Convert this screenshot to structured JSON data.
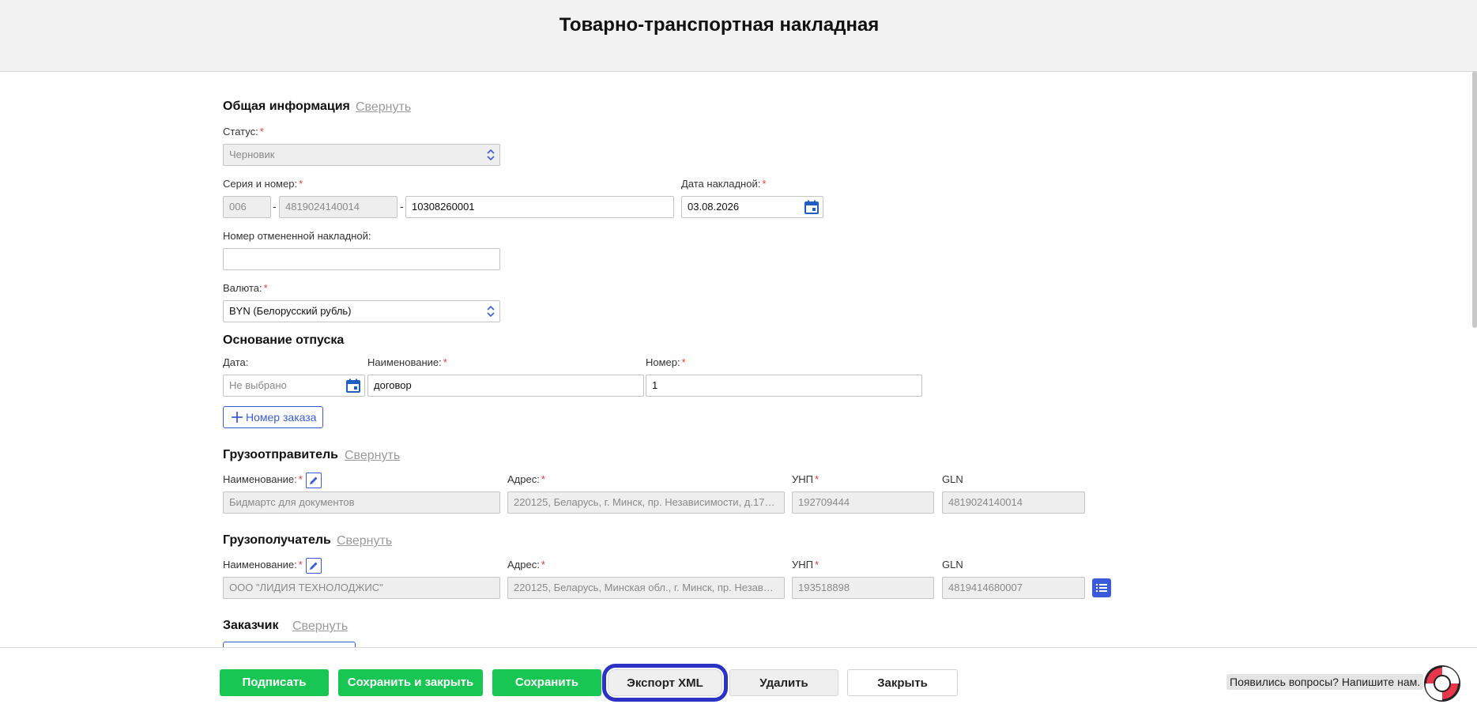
{
  "header": {
    "title": "Товарно-транспортная накладная"
  },
  "general": {
    "title": "Общая информация",
    "collapse": "Свернуть",
    "status_label": "Статус:",
    "status_value": "Черновик",
    "series_label": "Серия и номер:",
    "series_part1": "006",
    "series_part2": "4819024140014",
    "series_part3": "10308260001",
    "dash": "-",
    "date_label": "Дата накладной:",
    "date_value": "03.08.2026",
    "cancelled_label": "Номер отмененной накладной:",
    "cancelled_value": "",
    "currency_label": "Валюта:",
    "currency_value": "BYN (Белорусский рубль)",
    "required_mark": "*"
  },
  "basis": {
    "title": "Основание отпуска",
    "date_label": "Дата:",
    "date_placeholder": "Не выбрано",
    "name_label": "Наименование:",
    "name_value": "договор",
    "number_label": "Номер:",
    "number_value": "1",
    "order_button": "Номер заказа"
  },
  "shipper": {
    "title": "Грузоотправитель",
    "collapse": "Свернуть",
    "name_label": "Наименование:",
    "name_value": "Бидмартс для документов",
    "address_label": "Адрес:",
    "address_value": "220125, Беларусь, г. Минск, пр. Независимости, д.17…",
    "unp_label": "УНП",
    "unp_value": "192709444",
    "gln_label": "GLN",
    "gln_value": "4819024140014"
  },
  "consignee": {
    "title": "Грузополучатель",
    "collapse": "Свернуть",
    "name_label": "Наименование:",
    "name_value": "ООО \"ЛИДИЯ ТЕХНОЛОДЖИС\"",
    "address_label": "Адрес:",
    "address_value": "220125, Беларусь, Минская обл., г. Минск, пр.  Незав…",
    "unp_label": "УНП",
    "unp_value": "193518898",
    "gln_label": "GLN",
    "gln_value": "4819414680007"
  },
  "customer": {
    "title": "Заказчик",
    "collapse": "Свернуть"
  },
  "footer": {
    "sign": "Подписать",
    "save_close": "Сохранить и закрыть",
    "save": "Сохранить",
    "export_xml": "Экспорт XML",
    "delete": "Удалить",
    "close": "Закрыть",
    "help_text": "Появились вопросы? Напишите нам."
  },
  "colors": {
    "accent": "#3b5bdb",
    "green": "#17c653",
    "required": "#e53935",
    "focus_ring": "#2b33c4"
  }
}
